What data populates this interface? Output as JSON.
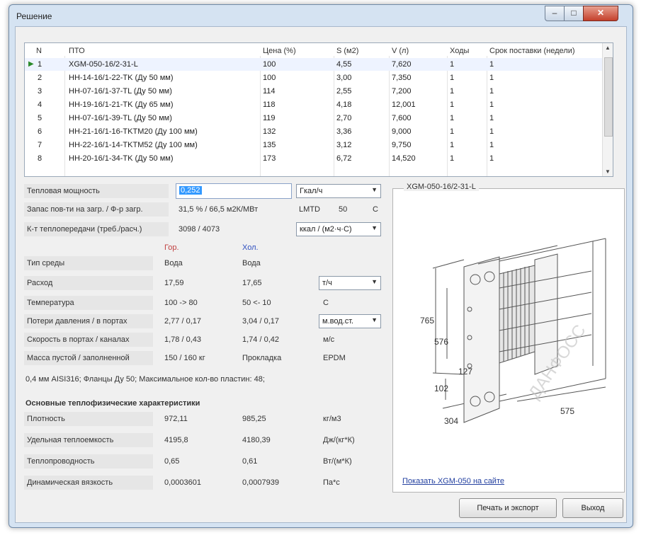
{
  "window": {
    "title": "Решение"
  },
  "grid": {
    "columns": [
      "N",
      "ПТО",
      "Цена (%)",
      "S (м2)",
      "V (л)",
      "Ходы",
      "Срок поставки (недели)"
    ],
    "rows": [
      [
        "1",
        "XGM-050-16/2-31-L",
        "100",
        "4,55",
        "7,620",
        "1",
        "1"
      ],
      [
        "2",
        "HH-14-16/1-22-TK (Ду 50 мм)",
        "100",
        "3,00",
        "7,350",
        "1",
        "1"
      ],
      [
        "3",
        "HH-07-16/1-37-TL (Ду 50 мм)",
        "114",
        "2,55",
        "7,200",
        "1",
        "1"
      ],
      [
        "4",
        "HH-19-16/1-21-TK (Ду 65 мм)",
        "118",
        "4,18",
        "12,001",
        "1",
        "1"
      ],
      [
        "5",
        "HH-07-16/1-39-TL (Ду 50 мм)",
        "119",
        "2,70",
        "7,600",
        "1",
        "1"
      ],
      [
        "6",
        "HH-21-16/1-16-TKTM20 (Ду 100 мм)",
        "132",
        "3,36",
        "9,000",
        "1",
        "1"
      ],
      [
        "7",
        "HH-22-16/1-14-TKTM52 (Ду 100 мм)",
        "135",
        "3,12",
        "9,750",
        "1",
        "1"
      ],
      [
        "8",
        "HH-20-16/1-34-TK (Ду 50 мм)",
        "173",
        "6,72",
        "14,520",
        "1",
        "1"
      ]
    ]
  },
  "form": {
    "heat_power_label": "Тепловая мощность",
    "heat_power_value": "0,252",
    "heat_power_unit": "Гкал/ч",
    "reserve_label": "Запас пов-ти на загр. / Ф-р загр.",
    "reserve_value": "31,5 %   /   66,5 м2К/МВт",
    "lmtd_label": "LMTD",
    "lmtd_value": "50",
    "lmtd_unit": "C",
    "coef_label": "К-т теплопередачи (треб./расч.)",
    "coef_value": "3098 / 4073",
    "coef_unit": "ккал / (м2·ч·C)",
    "hot_header": "Гор.",
    "cold_header": "Хол.",
    "medium_label": "Тип среды",
    "medium_hot": "Вода",
    "medium_cold": "Вода",
    "flow_label": "Расход",
    "flow_hot": "17,59",
    "flow_cold": "17,65",
    "flow_unit": "т/ч",
    "temp_label": "Температура",
    "temp_hot": "100 -> 80",
    "temp_cold": "50 <- 10",
    "temp_unit": "C",
    "pressure_label": "Потери давления / в портах",
    "pressure_hot": "2,77 / 0,17",
    "pressure_cold": "3,04 / 0,17",
    "pressure_unit": "м.вод.ст.",
    "speed_label": "Скорость в портах / каналах",
    "speed_hot": "1,78 / 0,43",
    "speed_cold": "1,74 / 0,42",
    "speed_unit": "м/с",
    "mass_label": "Масса пустой / заполненной",
    "mass_value": "150  /  160 кг",
    "gasket_label": "Прокладка",
    "gasket_value": "EPDM",
    "note": "0,4 мм  AISI316;  Фланцы Ду 50; Максимальное кол-во пластин: 48;",
    "props_title": "Основные теплофизические характеристики",
    "density_label": "Плотность",
    "density_hot": "972,11",
    "density_cold": "985,25",
    "density_unit": "кг/м3",
    "heatcap_label": "Удельная теплоемкость",
    "heatcap_hot": "4195,8",
    "heatcap_cold": "4180,39",
    "heatcap_unit": "Дж/(кг*К)",
    "conduct_label": "Теплопроводность",
    "conduct_hot": "0,65",
    "conduct_cold": "0,61",
    "conduct_unit": "Вт/(м*К)",
    "visc_label": "Динамическая вязкость",
    "visc_hot": "0,0003601",
    "visc_cold": "0,0007939",
    "visc_unit": "Па*с"
  },
  "drawing": {
    "title": "XGM-050-16/2-31-L",
    "dim_765": "765",
    "dim_576": "576",
    "dim_127": "127",
    "dim_102": "102",
    "dim_304": "304",
    "dim_575": "575",
    "watermark": "ДАНФОСС",
    "link": "Показать XGM-050 на сайте"
  },
  "buttons": {
    "print": "Печать и экспорт",
    "exit": "Выход"
  }
}
